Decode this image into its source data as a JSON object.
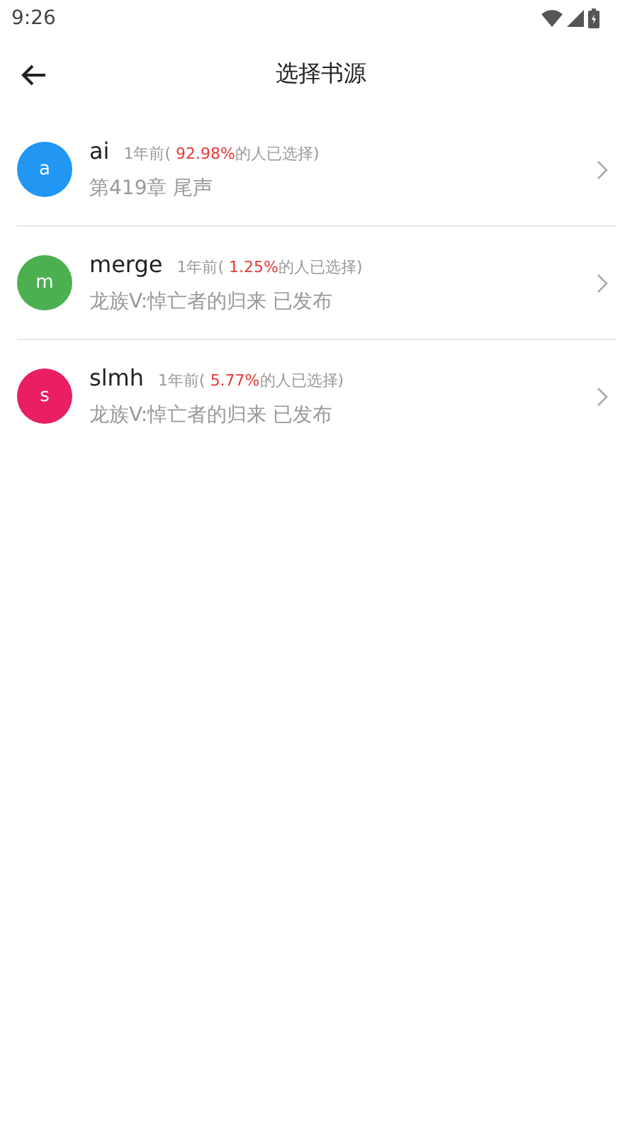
{
  "status_bar": {
    "time": "9:26"
  },
  "toolbar": {
    "title": "选择书源"
  },
  "sources": [
    {
      "initial": "a",
      "color": "#2196f3",
      "name": "ai",
      "time": "1年前(",
      "percent": "92.98%",
      "suffix": "的人已选择)",
      "latest": "第419章 尾声"
    },
    {
      "initial": "m",
      "color": "#4caf50",
      "name": "merge",
      "time": "1年前(",
      "percent": "1.25%",
      "suffix": "的人已选择)",
      "latest": "龙族V:悼亡者的归来 已发布"
    },
    {
      "initial": "s",
      "color": "#e91e63",
      "name": "slmh",
      "time": "1年前(",
      "percent": "5.77%",
      "suffix": "的人已选择)",
      "latest": "龙族V:悼亡者的归来 已发布"
    }
  ]
}
